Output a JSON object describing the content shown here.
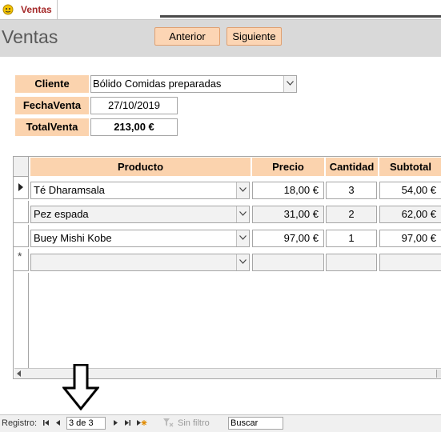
{
  "tab": {
    "label": "Ventas"
  },
  "header": {
    "title": "Ventas",
    "prev_label": "Anterior",
    "next_label": "Siguiente"
  },
  "fields": {
    "cliente": {
      "label": "Cliente",
      "value": "Bólido Comidas preparadas"
    },
    "fecha": {
      "label": "FechaVenta",
      "value": "27/10/2019"
    },
    "total": {
      "label": "TotalVenta",
      "value": "213,00 €"
    }
  },
  "subform": {
    "columns": [
      "Producto",
      "Precio",
      "Cantidad",
      "Subtotal"
    ],
    "rows": [
      {
        "producto": "Té Dharamsala",
        "precio": "18,00 €",
        "cantidad": "3",
        "subtotal": "54,00 €"
      },
      {
        "producto": "Pez espada",
        "precio": "31,00 €",
        "cantidad": "2",
        "subtotal": "62,00 €"
      },
      {
        "producto": "Buey Mishi Kobe",
        "precio": "97,00 €",
        "cantidad": "1",
        "subtotal": "97,00 €"
      }
    ],
    "new_row_marker": "*"
  },
  "statusbar": {
    "label": "Registro:",
    "record": "3 de 3",
    "filter": "Sin filtro",
    "search": "Buscar"
  },
  "colors": {
    "accent": "#fbd3ae",
    "button": "#fcd5b4",
    "header_bg": "#d9d9d9",
    "tab_text": "#a52a2a"
  }
}
